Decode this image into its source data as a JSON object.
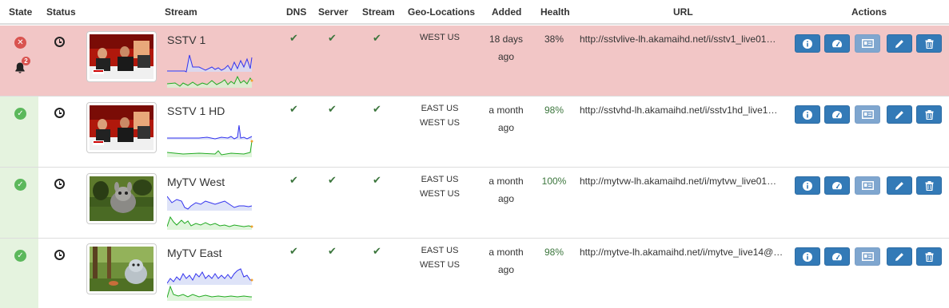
{
  "header": {
    "state": "State",
    "status": "Status",
    "stream": "Stream",
    "dns": "DNS",
    "server": "Server",
    "stream_check": "Stream",
    "geo": "Geo-Locations",
    "added": "Added",
    "health": "Health",
    "url": "URL",
    "actions": "Actions"
  },
  "rows": [
    {
      "state": "error",
      "notifications": "2",
      "name": "SSTV 1",
      "geo": [
        "WEST US"
      ],
      "added_line1": "18 days",
      "added_line2": "ago",
      "health": "38%",
      "url": "http://sstvlive-lh.akamaihd.net/i/sstv1_live01…"
    },
    {
      "state": "ok",
      "name": "SSTV 1 HD",
      "geo": [
        "EAST US",
        "WEST US"
      ],
      "added_line1": "a month",
      "added_line2": "ago",
      "health": "98%",
      "url": "http://sstvhd-lh.akamaihd.net/i/sstv1hd_live1…"
    },
    {
      "state": "ok",
      "name": "MyTV West",
      "geo": [
        "EAST US",
        "WEST US"
      ],
      "added_line1": "a month",
      "added_line2": "ago",
      "health": "100%",
      "url": "http://mytvw-lh.akamaihd.net/i/mytvw_live01…"
    },
    {
      "state": "ok",
      "name": "MyTV East",
      "geo": [
        "EAST US",
        "WEST US"
      ],
      "added_line1": "a month",
      "added_line2": "ago",
      "health": "98%",
      "url": "http://mytve-lh.akamaihd.net/i/mytve_live14@…"
    }
  ],
  "icons": {
    "state_ok": "check-circle-icon",
    "state_error": "x-circle-icon",
    "status": "clock-icon",
    "alerts": "bell-icon",
    "check": "checkmark-icon",
    "actions": [
      "info-icon",
      "dashboard-icon",
      "screenshot-icon",
      "edit-pencil-icon",
      "trash-icon"
    ]
  },
  "colors": {
    "error_row": "#f2c6c6",
    "ok_state": "#e5f3df",
    "button": "#337ab7",
    "success": "#3c763d"
  }
}
